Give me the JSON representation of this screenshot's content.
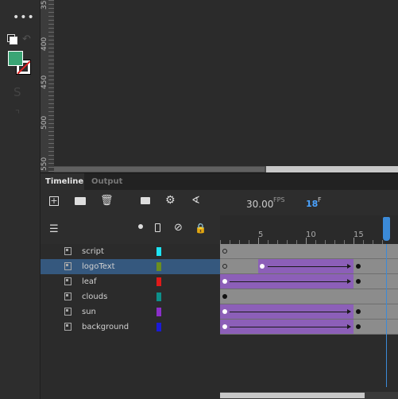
{
  "panel": {
    "tabs": [
      {
        "label": "Timeline"
      },
      {
        "label": "Output"
      }
    ]
  },
  "stage_ruler": {
    "ticks": [
      "350",
      "400",
      "450",
      "500",
      "550"
    ]
  },
  "timeline": {
    "fps_value": "30.00",
    "fps_unit": "FPS",
    "frame_value": "18",
    "frame_unit": "F",
    "ruler_numbers": [
      "5",
      "10",
      "15"
    ],
    "toolbar_icons": [
      "new-layer-icon",
      "new-folder-icon",
      "delete-icon",
      "camera-icon",
      "parent-hierarchy-icon",
      "graph-icon"
    ],
    "layer_header_icons": [
      "layers-icon",
      "dot-icon",
      "outline-icon",
      "eye-hidden-icon",
      "lock-icon"
    ],
    "layers": [
      {
        "name": "script",
        "color": "#1ee4f4",
        "selected": false
      },
      {
        "name": "logoText",
        "color": "#6b8e1f",
        "selected": true
      },
      {
        "name": "leaf",
        "color": "#e01a1a",
        "selected": false
      },
      {
        "name": "clouds",
        "color": "#0d8f8a",
        "selected": false
      },
      {
        "name": "sun",
        "color": "#8b2fc9",
        "selected": false
      },
      {
        "name": "background",
        "color": "#1a1ad6",
        "selected": false
      }
    ]
  },
  "tools": {
    "icons": [
      "more-icon",
      "swap-colors-icon",
      "undo-icon",
      "fill-color-swatch",
      "stroke-color-swatch"
    ],
    "fill_color": "#3aa575"
  },
  "colors": {
    "tween": "#8c5fb8",
    "playhead": "#3b8ad8",
    "accent_blue": "#4aa3ff"
  }
}
